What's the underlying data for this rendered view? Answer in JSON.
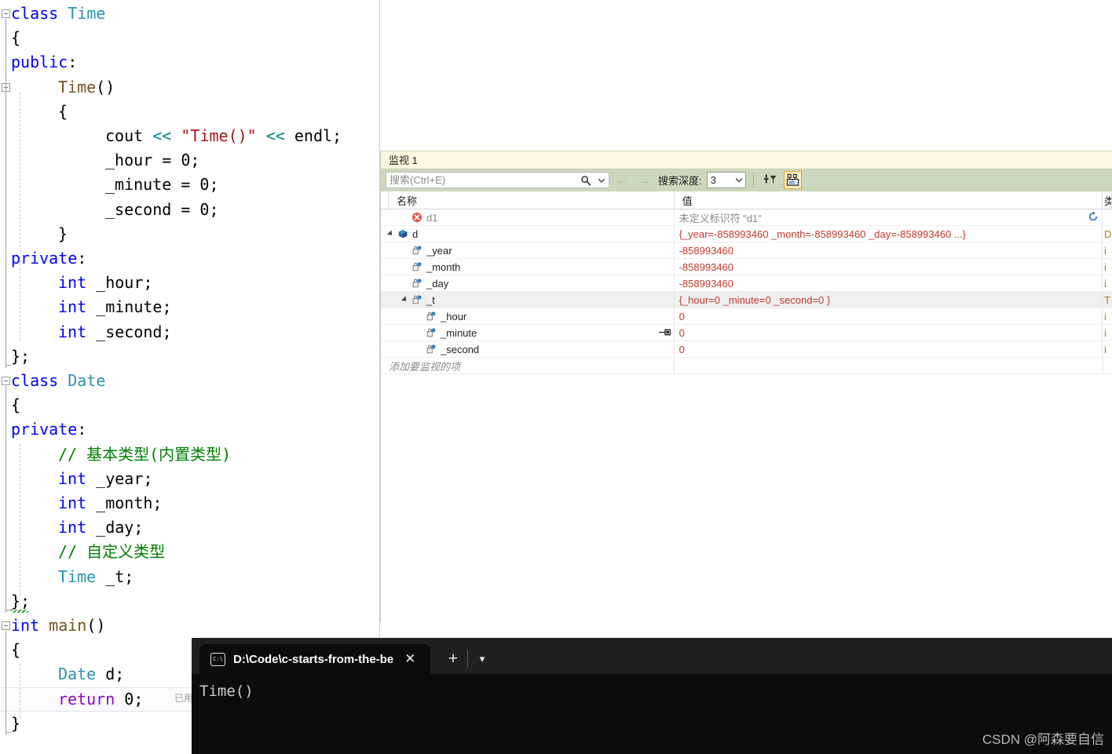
{
  "editor": {
    "lines": [
      {
        "indent": 0,
        "tokens": [
          {
            "t": "class ",
            "c": "kw"
          },
          {
            "t": "Time",
            "c": "type"
          }
        ]
      },
      {
        "indent": 0,
        "tokens": [
          {
            "t": "{",
            "c": "plain"
          }
        ]
      },
      {
        "indent": 0,
        "tokens": [
          {
            "t": "public",
            "c": "kw"
          },
          {
            "t": ":",
            "c": "plain"
          }
        ]
      },
      {
        "indent": 1,
        "tokens": [
          {
            "t": "Time",
            "c": "fn"
          },
          {
            "t": "()",
            "c": "plain"
          }
        ]
      },
      {
        "indent": 1,
        "tokens": [
          {
            "t": "{",
            "c": "plain"
          }
        ]
      },
      {
        "indent": 2,
        "tokens": [
          {
            "t": "cout ",
            "c": "plain"
          },
          {
            "t": "<<",
            "c": "op"
          },
          {
            "t": " ",
            "c": "plain"
          },
          {
            "t": "\"Time()\"",
            "c": "str"
          },
          {
            "t": " ",
            "c": "plain"
          },
          {
            "t": "<<",
            "c": "op"
          },
          {
            "t": " endl;",
            "c": "plain"
          }
        ]
      },
      {
        "indent": 2,
        "tokens": [
          {
            "t": "_hour = 0;",
            "c": "plain"
          }
        ]
      },
      {
        "indent": 2,
        "tokens": [
          {
            "t": "_minute = 0;",
            "c": "plain"
          }
        ]
      },
      {
        "indent": 2,
        "tokens": [
          {
            "t": "_second = 0;",
            "c": "plain"
          }
        ]
      },
      {
        "indent": 1,
        "tokens": [
          {
            "t": "}",
            "c": "plain"
          }
        ]
      },
      {
        "indent": 0,
        "tokens": [
          {
            "t": "private",
            "c": "kw"
          },
          {
            "t": ":",
            "c": "plain"
          }
        ]
      },
      {
        "indent": 1,
        "tokens": [
          {
            "t": "int",
            "c": "kw"
          },
          {
            "t": " _hour;",
            "c": "plain"
          }
        ]
      },
      {
        "indent": 1,
        "tokens": [
          {
            "t": "int",
            "c": "kw"
          },
          {
            "t": " _minute;",
            "c": "plain"
          }
        ]
      },
      {
        "indent": 1,
        "tokens": [
          {
            "t": "int",
            "c": "kw"
          },
          {
            "t": " _second;",
            "c": "plain"
          }
        ]
      },
      {
        "indent": 0,
        "tokens": [
          {
            "t": "};",
            "c": "plain"
          }
        ]
      },
      {
        "indent": 0,
        "tokens": [
          {
            "t": "class ",
            "c": "kw"
          },
          {
            "t": "Date",
            "c": "type"
          }
        ]
      },
      {
        "indent": 0,
        "tokens": [
          {
            "t": "{",
            "c": "plain"
          }
        ]
      },
      {
        "indent": 0,
        "tokens": [
          {
            "t": "private",
            "c": "kw"
          },
          {
            "t": ":",
            "c": "plain"
          }
        ]
      },
      {
        "indent": 1,
        "tokens": [
          {
            "t": "// 基本类型(内置类型)",
            "c": "cmt"
          }
        ]
      },
      {
        "indent": 1,
        "tokens": [
          {
            "t": "int",
            "c": "kw"
          },
          {
            "t": " _year;",
            "c": "plain"
          }
        ]
      },
      {
        "indent": 1,
        "tokens": [
          {
            "t": "int",
            "c": "kw"
          },
          {
            "t": " _month;",
            "c": "plain"
          }
        ]
      },
      {
        "indent": 1,
        "tokens": [
          {
            "t": "int",
            "c": "kw"
          },
          {
            "t": " _day;",
            "c": "plain"
          }
        ]
      },
      {
        "indent": 1,
        "tokens": [
          {
            "t": "// 自定义类型",
            "c": "cmt"
          }
        ]
      },
      {
        "indent": 1,
        "tokens": [
          {
            "t": "Time",
            "c": "type"
          },
          {
            "t": " _t;",
            "c": "plain"
          }
        ]
      },
      {
        "indent": 0,
        "tokens": [
          {
            "t": "};",
            "c": "plain"
          }
        ]
      },
      {
        "indent": 0,
        "tokens": [
          {
            "t": "int ",
            "c": "kw"
          },
          {
            "t": "main",
            "c": "fn"
          },
          {
            "t": "()",
            "c": "plain"
          }
        ]
      },
      {
        "indent": 0,
        "tokens": [
          {
            "t": "{",
            "c": "plain"
          }
        ]
      },
      {
        "indent": 1,
        "tokens": [
          {
            "t": "Date",
            "c": "type"
          },
          {
            "t": " d;",
            "c": "plain"
          }
        ]
      },
      {
        "indent": 1,
        "current": true,
        "tokens": [
          {
            "t": "return",
            "c": "ret"
          },
          {
            "t": " 0;",
            "c": "plain"
          }
        ]
      },
      {
        "indent": 0,
        "tokens": [
          {
            "t": "}",
            "c": "plain"
          }
        ]
      }
    ],
    "codelens_text": "已用"
  },
  "watch": {
    "title": "监视 1",
    "search_placeholder": "搜索(Ctrl+E)",
    "search_value": "",
    "search_icon": "search-icon",
    "dropdown_icon": "chevron-down-icon",
    "nav_back_icon": "arrow-left-icon",
    "nav_forward_icon": "arrow-right-icon",
    "depth_label": "搜索深度:",
    "depth_value": "3",
    "filter_icon": "filter-pin-icon",
    "hex_icon": "tab-layout-icon",
    "columns": [
      "名称",
      "值",
      "类"
    ],
    "rows": [
      {
        "name": "d1",
        "value": "未定义标识符 \"d1\"",
        "type": "",
        "icon": "error-circle-icon",
        "indent": 1,
        "expander": "none",
        "value_error": true,
        "refresh": true
      },
      {
        "name": "d",
        "value": "{_year=-858993460 _month=-858993460 _day=-858993460 ...}",
        "type": "D",
        "icon": "object-box-icon",
        "indent": 0,
        "expander": "expanded"
      },
      {
        "name": "_year",
        "value": "-858993460",
        "type": "i",
        "icon": "field-lock-icon",
        "indent": 1,
        "expander": "none"
      },
      {
        "name": "_month",
        "value": "-858993460",
        "type": "i",
        "icon": "field-lock-icon",
        "indent": 1,
        "expander": "none"
      },
      {
        "name": "_day",
        "value": "-858993460",
        "type": "i",
        "icon": "field-lock-icon",
        "indent": 1,
        "expander": "none"
      },
      {
        "name": "_t",
        "value": "{_hour=0 _minute=0 _second=0 }",
        "type": "T",
        "icon": "field-lock-icon",
        "indent": 1,
        "expander": "expanded",
        "highlight": true
      },
      {
        "name": "_hour",
        "value": "0",
        "type": "i",
        "icon": "field-lock-icon",
        "indent": 2,
        "expander": "none"
      },
      {
        "name": "_minute",
        "value": "0",
        "type": "i",
        "icon": "field-lock-icon",
        "indent": 2,
        "expander": "none",
        "pin": true
      },
      {
        "name": "_second",
        "value": "0",
        "type": "i",
        "icon": "field-lock-icon",
        "indent": 2,
        "expander": "none"
      }
    ],
    "add_watch_text": "添加要监视的项"
  },
  "terminal": {
    "tab_title": "D:\\Code\\c-starts-from-the-be",
    "tab_icon": "console-icon",
    "close_icon": "close-icon",
    "new_tab_icon": "plus-icon",
    "dropdown_icon": "chevron-down-icon",
    "output": "Time()"
  },
  "watermark": "CSDN @阿森要自信",
  "colors": {
    "keyword": "#0000ff",
    "type": "#2b91af",
    "string": "#a31515",
    "comment": "#008000",
    "return": "#8f08c4",
    "watch_value": "#c0392b",
    "watch_title_bg": "#fdf6e3",
    "watch_toolbar_bg": "#ccd8bb",
    "terminal_bg": "#0c0c0c"
  }
}
